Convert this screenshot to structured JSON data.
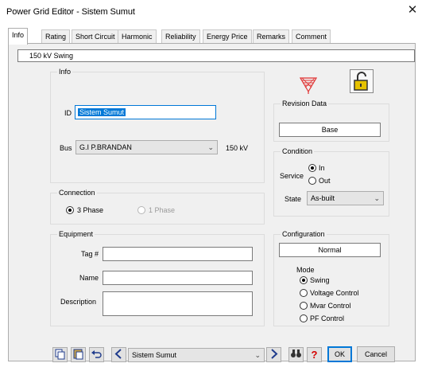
{
  "window": {
    "title": "Power Grid Editor - Sistem Sumut",
    "close_symbol": "✕"
  },
  "tabs": [
    "Info",
    "Rating",
    "Short Circuit",
    "Harmonic",
    "Reliability",
    "Energy Price",
    "Remarks",
    "Comment"
  ],
  "header": {
    "text": "150 kV  Swing"
  },
  "info": {
    "legend": "Info",
    "id_label": "ID",
    "id_value": "Sistem Sumut",
    "bus_label": "Bus",
    "bus_value": "G.I P.BRANDAN",
    "bus_kv": "150 kV"
  },
  "connection": {
    "legend": "Connection",
    "option1": "3 Phase",
    "option2": "1 Phase",
    "selected": "3 Phase"
  },
  "equipment": {
    "legend": "Equipment",
    "tag_label": "Tag #",
    "name_label": "Name",
    "description_label": "Description",
    "tag_value": "",
    "name_value": "",
    "description_value": ""
  },
  "revision": {
    "legend": "Revision Data",
    "value": "Base"
  },
  "condition": {
    "legend": "Condition",
    "service_label": "Service",
    "service_in": "In",
    "service_out": "Out",
    "service_selected": "In",
    "state_label": "State",
    "state_value": "As-built"
  },
  "configuration": {
    "legend": "Configuration",
    "value": "Normal",
    "mode_label": "Mode",
    "modes": [
      "Swing",
      "Voltage Control",
      "Mvar Control",
      "PF Control"
    ],
    "mode_selected": "Swing"
  },
  "toolbar": {
    "nav_value": "Sistem Sumut",
    "ok_label": "OK",
    "cancel_label": "Cancel",
    "help_label": "?"
  },
  "icons": [
    "grid-source-icon",
    "lock-icon",
    "copy-icon",
    "paste-icon",
    "undo-icon",
    "prev-icon",
    "next-icon",
    "binoculars-icon",
    "help-icon"
  ],
  "colors": {
    "accent": "#0078d7",
    "grid_icon": "#e03030",
    "help": "#d40000"
  }
}
